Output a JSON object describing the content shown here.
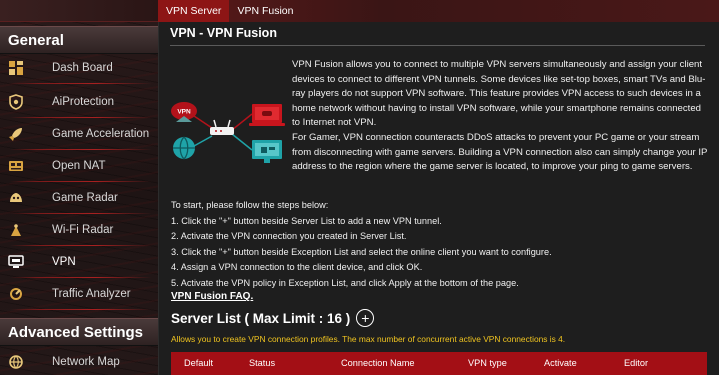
{
  "tabs": [
    {
      "label": "VPN Server",
      "active": true
    },
    {
      "label": "VPN Fusion",
      "active": false
    }
  ],
  "sidebar": {
    "sections": [
      {
        "label": "General"
      },
      {
        "label": "Advanced Settings"
      }
    ],
    "items": [
      {
        "label": "Dash Board",
        "icon": "dashboard-icon"
      },
      {
        "label": "AiProtection",
        "icon": "shield-icon"
      },
      {
        "label": "Game Acceleration",
        "icon": "rocket-icon"
      },
      {
        "label": "Open NAT",
        "icon": "nat-icon"
      },
      {
        "label": "Game Radar",
        "icon": "radar-icon"
      },
      {
        "label": "Wi-Fi Radar",
        "icon": "wifi-radar-icon"
      },
      {
        "label": "VPN",
        "icon": "vpn-icon",
        "active": true
      },
      {
        "label": "Traffic Analyzer",
        "icon": "traffic-analyzer-icon"
      },
      {
        "label": "Network Map",
        "icon": "network-map-icon"
      }
    ]
  },
  "main": {
    "title": "VPN - VPN Fusion",
    "intro_p1": "VPN Fusion allows you to connect to multiple VPN servers simultaneously and assign your client devices to connect to different VPN tunnels. Some devices like set-top boxes, smart TVs and Blu-ray players do not support VPN software. This feature provides VPN access to such devices in a home network without having to install VPN software, while your smartphone remains connected to Internet not VPN.",
    "intro_p2": "For Gamer, VPN connection counteracts DDoS attacks to prevent your PC game or your stream from disconnecting with game servers. Building a VPN connection also can simply change your IP address to the region where the game server is located, to improve your ping to game servers.",
    "illustration_label": "VPN",
    "steps_intro": "To start, please follow the steps below:",
    "steps": [
      "1. Click the \"+\" button beside Server List to add a new VPN tunnel.",
      "2. Activate the VPN connection you created in Server List.",
      "3. Click the \"+\" button beside Exception List and select the online client you want to configure.",
      "4. Assign a VPN connection to the client device, and click OK.",
      "5. Activate the VPN policy in Exception List, and click Apply at the bottom of the page."
    ],
    "faq_link": "VPN Fusion FAQ.",
    "server_list_title": "Server List ( Max Limit : 16 )",
    "add_button": "+",
    "server_note": "Allows you to create VPN connection profiles. The max number of concurrent active VPN connections is 4.",
    "table_headers": [
      "Default",
      "Status",
      "Connection Name",
      "VPN type",
      "Activate",
      "Editor"
    ]
  },
  "colors": {
    "accent_red": "#a30f15",
    "note_yellow": "#f0c420"
  }
}
